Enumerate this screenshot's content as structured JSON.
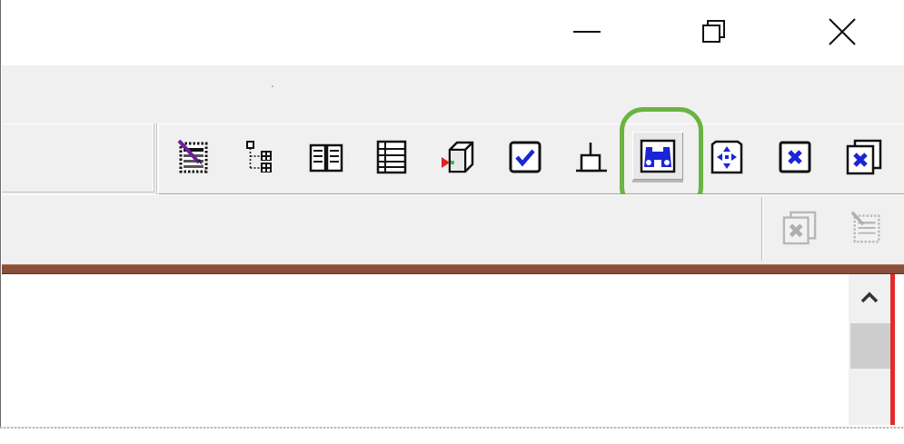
{
  "window": {
    "controls": [
      {
        "name": "minimize-button",
        "icon": "minimize-icon"
      },
      {
        "name": "restore-button",
        "icon": "restore-icon"
      },
      {
        "name": "close-button",
        "icon": "close-icon"
      }
    ]
  },
  "toolbar": {
    "buttons": [
      {
        "icon": "edit-document-icon"
      },
      {
        "icon": "tree-structure-icon"
      },
      {
        "icon": "open-book-icon"
      },
      {
        "icon": "list-document-icon"
      },
      {
        "icon": "cube-insert-icon"
      },
      {
        "icon": "check-box-icon"
      },
      {
        "icon": "connector-icon"
      },
      {
        "icon": "binoculars-icon",
        "state": "pressed",
        "highlighted": true
      },
      {
        "icon": "move-arrows-icon"
      },
      {
        "icon": "delete-box-icon"
      },
      {
        "icon": "delete-copy-icon"
      }
    ],
    "secondary_buttons": [
      {
        "icon": "delete-copy-disabled-icon",
        "enabled": false
      },
      {
        "icon": "edit-page-disabled-icon",
        "enabled": false
      }
    ]
  },
  "scrollbar": {
    "up_icon": "chevron-up-icon"
  },
  "colors": {
    "highlight_ring": "#6ab441",
    "divider": "#8a4e39",
    "edge_accent": "#e32b2b",
    "icon_blue": "#1a25d6"
  }
}
